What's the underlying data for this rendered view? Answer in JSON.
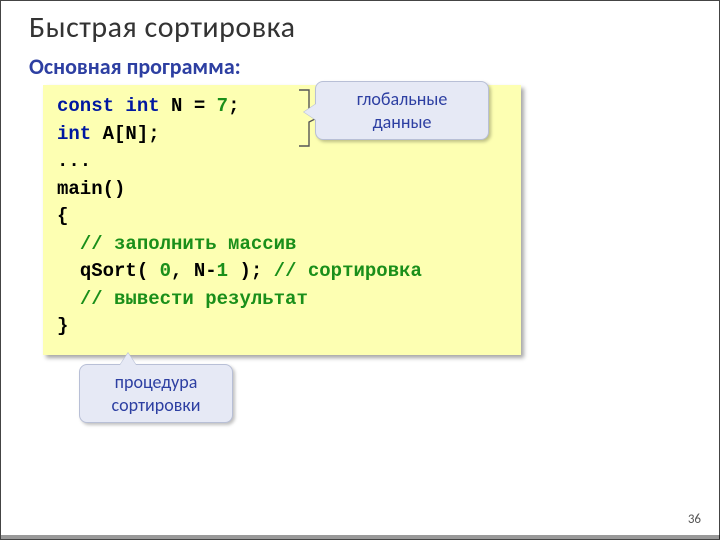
{
  "title": "Быстрая сортировка",
  "subtitle": "Основная программа:",
  "code": {
    "l1": {
      "kw1": "const",
      "kw2": "int",
      "id": "N",
      "eq": "=",
      "num": "7",
      "semi": ";"
    },
    "l2": {
      "kw": "int",
      "rest": " A[N];"
    },
    "l3": "...",
    "l4": "main()",
    "l5": "{",
    "l6": {
      "indent": "  ",
      "cmt": "// заполнить массив"
    },
    "l7": {
      "indent": "  ",
      "a": "qSort( ",
      "n0": "0",
      "b": ", N-",
      "n1": "1",
      "c": " ); ",
      "cmt": "// сортировка"
    },
    "l8": {
      "indent": "  ",
      "cmt": "// вывести результат"
    },
    "l9": "}"
  },
  "callout_global": "глобальные данные",
  "callout_proc_l1": "процедура",
  "callout_proc_l2": "сортировки",
  "page_number": "36"
}
